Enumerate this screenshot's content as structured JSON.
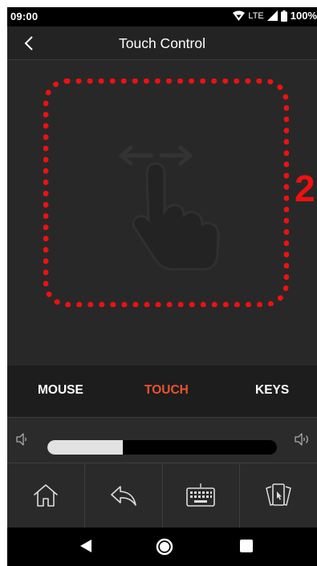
{
  "status_bar": {
    "time": "09:00",
    "network": "LTE",
    "battery": "100%"
  },
  "header": {
    "title": "Touch Control",
    "back_icon": "back-arrow-icon"
  },
  "touchpad": {
    "gesture_icon": "swipe-horizontal-icon",
    "callout": "2"
  },
  "tabs": [
    {
      "label": "MOUSE",
      "active": false
    },
    {
      "label": "TOUCH",
      "active": true
    },
    {
      "label": "KEYS",
      "active": false
    }
  ],
  "volume": {
    "level": 0.33,
    "down_icon": "volume-down-icon",
    "up_icon": "volume-up-icon"
  },
  "toolbar": {
    "items": [
      "home-icon",
      "return-icon",
      "keyboard-icon",
      "app-switch-icon"
    ]
  },
  "nav_bar": {
    "items": [
      "nav-back-icon",
      "nav-home-icon",
      "nav-recents-icon"
    ]
  },
  "colors": {
    "accent": "#e8542d",
    "highlight": "#ee1111",
    "background": "#272727"
  }
}
